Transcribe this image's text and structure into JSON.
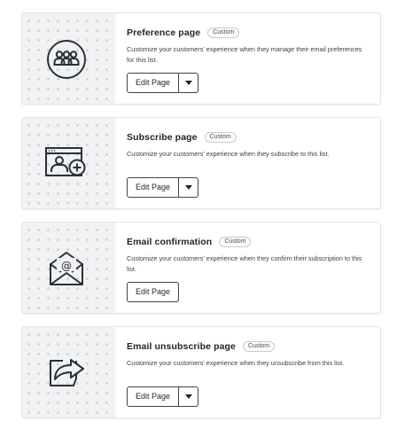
{
  "cards": [
    {
      "title": "Preference page",
      "badge": "Custom",
      "description": "Customize your customers' experience when they manage their email preferences for this list.",
      "button_label": "Edit Page",
      "has_dropdown": true,
      "icon": "people-group-icon"
    },
    {
      "title": "Subscribe page",
      "badge": "Custom",
      "description": "Customize your customers' experience when they subscribe to this list.",
      "button_label": "Edit Page",
      "has_dropdown": true,
      "icon": "add-user-window-icon"
    },
    {
      "title": "Email confirmation",
      "badge": "Custom",
      "description": "Customize your customers' experience when they confirm their subscription to this list.",
      "button_label": "Edit Page",
      "has_dropdown": false,
      "icon": "envelope-at-icon"
    },
    {
      "title": "Email unsubscribe page",
      "badge": "Custom",
      "description": "Customize your customers' experience when they unsubscribe from this list.",
      "button_label": "Edit Page",
      "has_dropdown": true,
      "icon": "share-arrow-icon"
    }
  ],
  "colors": {
    "border": "#e3e5e8",
    "thumb_bg": "#f1f2f3",
    "dots": "#d3d6da",
    "text": "#1f2329",
    "button_border": "#3d434b"
  }
}
